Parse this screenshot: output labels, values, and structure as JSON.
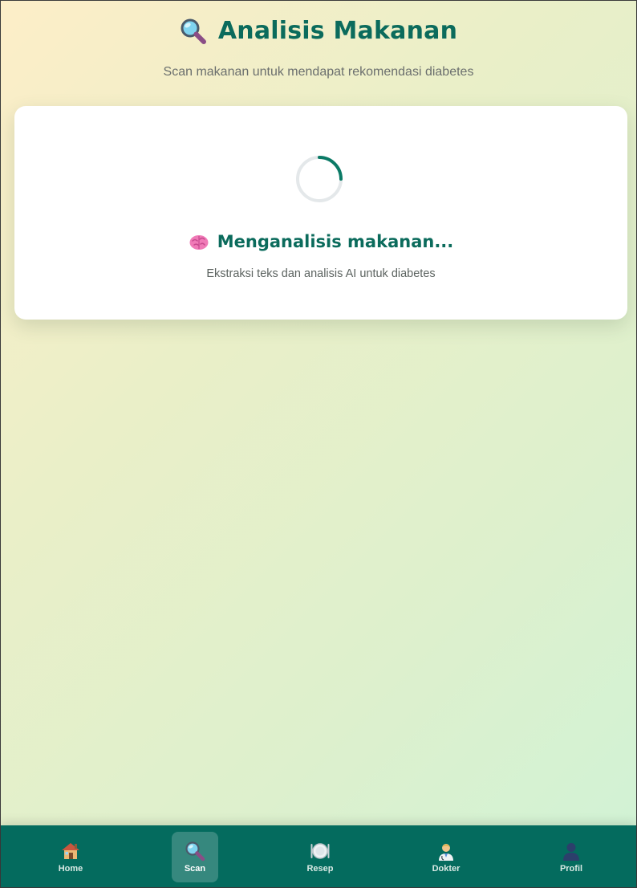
{
  "header": {
    "icon": "magnifier-icon",
    "title": "Analisis Makanan",
    "subtitle": "Scan makanan untuk mendapat rekomendasi diabetes"
  },
  "loading": {
    "icon": "brain-icon",
    "title": "Menganalisis makanan...",
    "description": "Ekstraksi teks dan analisis AI untuk diabetes"
  },
  "nav": {
    "active": "Scan",
    "items": [
      {
        "label": "Home",
        "icon": "house-icon"
      },
      {
        "label": "Scan",
        "icon": "magnifier-icon"
      },
      {
        "label": "Resep",
        "icon": "plate-icon"
      },
      {
        "label": "Dokter",
        "icon": "doctor-icon"
      },
      {
        "label": "Profil",
        "icon": "user-icon"
      }
    ]
  },
  "colors": {
    "accent": "#0b6b5c",
    "nav_background": "#046b5e",
    "card_background": "#ffffff"
  }
}
